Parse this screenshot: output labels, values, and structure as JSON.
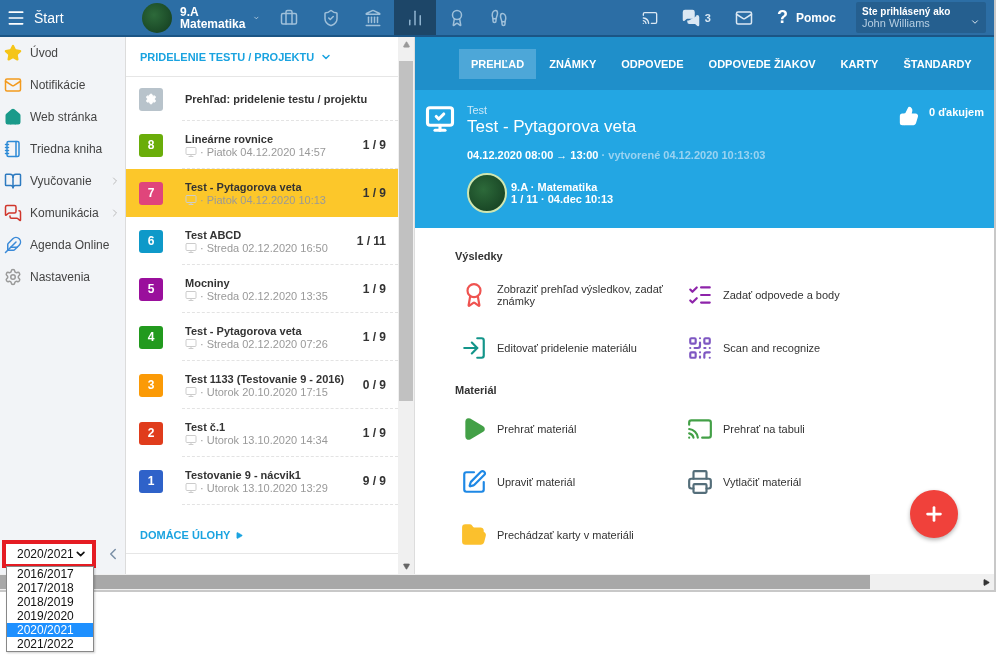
{
  "topbar": {
    "menu_label": "Štart",
    "class_name": "9.A",
    "subject": "Matematika",
    "nav": [
      {
        "kind": "briefcase",
        "selected": false
      },
      {
        "kind": "shield",
        "selected": false
      },
      {
        "kind": "building",
        "selected": false
      },
      {
        "kind": "chart",
        "selected": true
      },
      {
        "kind": "grade",
        "selected": false
      },
      {
        "kind": "walk",
        "selected": false
      }
    ],
    "chat_count": "3",
    "help_mark": "?",
    "help_label": "Pomoc",
    "user_caption": "Ste prihlásený ako",
    "user_name": "John Williams"
  },
  "sidebar": {
    "items": [
      {
        "label": "Úvod",
        "kind": "star",
        "expandable": false
      },
      {
        "label": "Notifikácie",
        "kind": "mail",
        "expandable": false
      },
      {
        "label": "Web stránka",
        "kind": "home",
        "expandable": false
      },
      {
        "label": "Triedna kniha",
        "kind": "notebook",
        "expandable": false
      },
      {
        "label": "Vyučovanie",
        "kind": "book",
        "expandable": true
      },
      {
        "label": "Komunikácia",
        "kind": "chat",
        "expandable": true
      },
      {
        "label": "Agenda Online",
        "kind": "feather",
        "expandable": false
      },
      {
        "label": "Nastavenia",
        "kind": "gear",
        "expandable": false
      }
    ],
    "year_select": {
      "value": "2020/2021",
      "options": [
        {
          "label": "2016/2017",
          "selected": false
        },
        {
          "label": "2017/2018",
          "selected": false
        },
        {
          "label": "2018/2019",
          "selected": false
        },
        {
          "label": "2019/2020",
          "selected": false
        },
        {
          "label": "2020/2021",
          "selected": true
        },
        {
          "label": "2021/2022",
          "selected": false
        }
      ]
    }
  },
  "assignments": {
    "heading": "PRIDELENIE TESTU / PROJEKTU",
    "overview": "Prehľad: pridelenie testu / projektu",
    "items": [
      {
        "number": "8",
        "color": "#6aad0a",
        "title": "Lineárne rovnice",
        "date": "· Piatok 04.12.2020 14:57",
        "score": "1 / 9",
        "selected": false
      },
      {
        "number": "7",
        "color": "#e0457b",
        "title": "Test - Pytagorova veta",
        "date": "· Piatok 04.12.2020 10:13",
        "score": "1 / 9",
        "selected": true
      },
      {
        "number": "6",
        "color": "#0e99c9",
        "title": "Test ABCD",
        "date": "· Streda 02.12.2020 16:50",
        "score": "1 / 11",
        "selected": false
      },
      {
        "number": "5",
        "color": "#9a0f9c",
        "title": "Mocniny",
        "date": "· Streda 02.12.2020 13:35",
        "score": "1 / 9",
        "selected": false
      },
      {
        "number": "4",
        "color": "#229a1e",
        "title": "Test - Pytagorova veta",
        "date": "· Streda 02.12.2020 07:26",
        "score": "1 / 9",
        "selected": false
      },
      {
        "number": "3",
        "color": "#fb9a06",
        "title": "Test 1133 (Testovanie 9 - 2016)",
        "date": "· Utorok 20.10.2020 17:15",
        "score": "0 / 9",
        "selected": false
      },
      {
        "number": "2",
        "color": "#e03c1c",
        "title": "Test č.1",
        "date": "· Utorok 13.10.2020 14:34",
        "score": "1 / 9",
        "selected": false
      },
      {
        "number": "1",
        "color": "#2f62c9",
        "title": "Testovanie 9 - nácvik1",
        "date": "· Utorok 13.10.2020 13:29",
        "score": "9 / 9",
        "selected": false
      }
    ],
    "footer": "DOMÁCE ÚLOHY"
  },
  "tabs": [
    {
      "label": "PREHĽAD",
      "selected": true
    },
    {
      "label": "ZNÁMKY",
      "selected": false
    },
    {
      "label": "ODPOVEDE",
      "selected": false
    },
    {
      "label": "ODPOVEDE ŽIAKOV",
      "selected": false
    },
    {
      "label": "KARTY",
      "selected": false
    },
    {
      "label": "ŠTANDARDY",
      "selected": false
    }
  ],
  "detail": {
    "type": "Test",
    "title": "Test - Pytagorova veta",
    "time": "04.12.2020 08:00 → 13:00",
    "created": "· vytvorené 04.12.2020 10:13:03",
    "class_line": "9.A · Matematika",
    "class_sub": "1 / 11 · 04.dec 10:13",
    "thanks": "0 ďakujem"
  },
  "sections": [
    {
      "title": "Výsledky",
      "actions": [
        {
          "label": "Zobraziť prehľad výsledkov, zadať známky",
          "kind": "grade"
        },
        {
          "label": "Zadať odpovede a body",
          "kind": "checklist"
        },
        {
          "label": "Editovať pridelenie materiálu",
          "kind": "enter"
        },
        {
          "label": "Scan and recognize",
          "kind": "qr"
        }
      ]
    },
    {
      "title": "Materiál",
      "actions": [
        {
          "label": "Prehrať materiál",
          "kind": "play"
        },
        {
          "label": "Prehrať na tabuli",
          "kind": "cast"
        },
        {
          "label": "Upraviť materiál",
          "kind": "edit"
        },
        {
          "label": "Vytlačiť materiál",
          "kind": "print"
        },
        {
          "label": "Prechádzať karty v materiáli",
          "kind": "folder"
        }
      ]
    }
  ]
}
